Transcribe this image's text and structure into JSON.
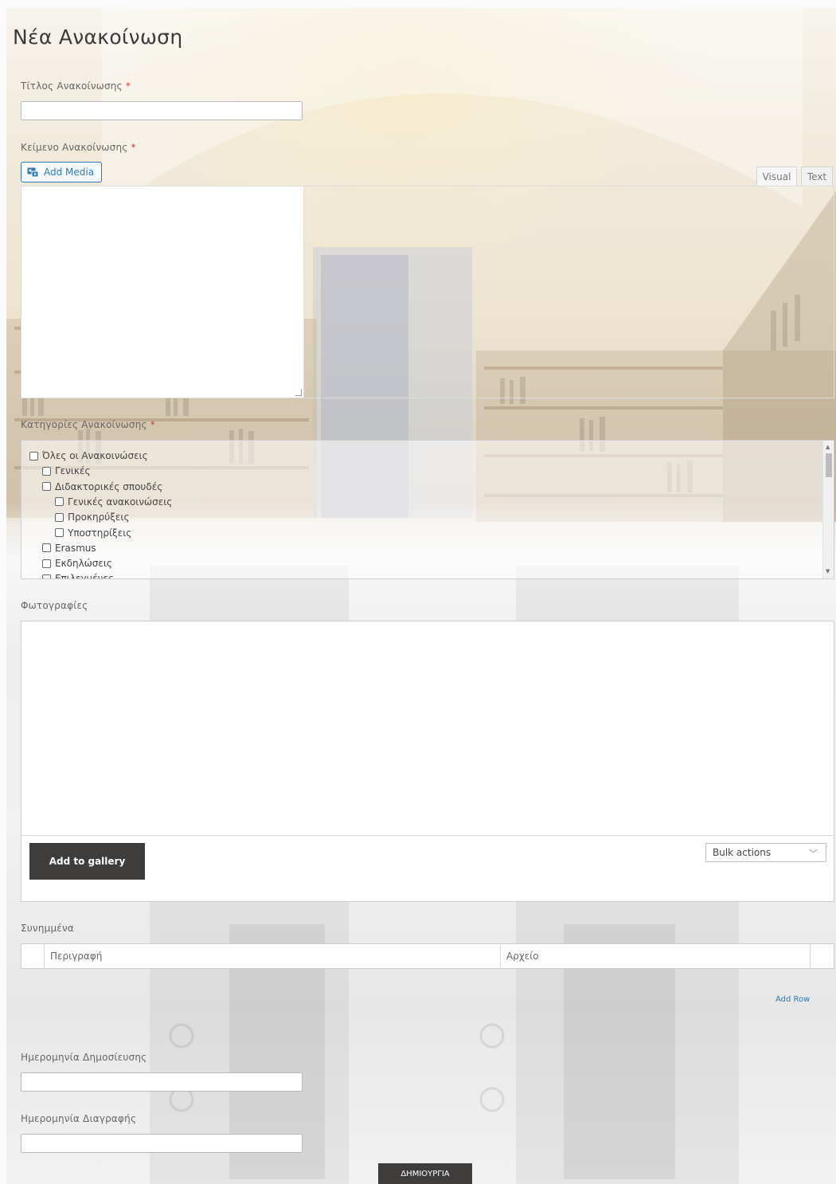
{
  "page": {
    "title": "Νέα Ανακοίνωση"
  },
  "announcement_title": {
    "label": "Τίτλος Ανακοίνωσης",
    "required_mark": "*",
    "value": ""
  },
  "announcement_text": {
    "label": "Κείμενο Ανακοίνωσης",
    "required_mark": "*",
    "add_media_label": "Add Media",
    "tabs": [
      {
        "label": "Visual",
        "active": true
      },
      {
        "label": "Text",
        "active": false
      }
    ],
    "value": ""
  },
  "categories": {
    "label": "Κατηγορίες Ανακοίνωσης",
    "required_mark": "*",
    "items": [
      {
        "label": "Όλες οι Ανακοινώσεις",
        "level": 0,
        "checked": false
      },
      {
        "label": "Γενικές",
        "level": 1,
        "checked": false
      },
      {
        "label": "Διδακτορικές σπουδές",
        "level": 1,
        "checked": false
      },
      {
        "label": "Γενικές ανακοινώσεις",
        "level": 2,
        "checked": false
      },
      {
        "label": "Προκηρύξεις",
        "level": 2,
        "checked": false
      },
      {
        "label": "Υποστηρίξεις",
        "level": 2,
        "checked": false
      },
      {
        "label": "Erasmus",
        "level": 1,
        "checked": false
      },
      {
        "label": "Εκδηλώσεις",
        "level": 1,
        "checked": false
      },
      {
        "label": "Επιλεγμένες",
        "level": 1,
        "checked": false
      }
    ]
  },
  "photos": {
    "label": "Φωτογραφίες",
    "add_button": "Add to gallery",
    "bulk_actions": "Bulk actions"
  },
  "attachments": {
    "label": "Συνημμένα",
    "columns": [
      "Περιγραφή",
      "Αρχείο"
    ],
    "add_row": "Add Row"
  },
  "publish_date": {
    "label": "Ημερομηνία Δημοσίευσης",
    "value": ""
  },
  "delete_date": {
    "label": "Ημερομηνία Διαγραφής",
    "value": ""
  },
  "submit": {
    "label": "ΔΗΜΙΟΥΡΓΙΑ"
  },
  "colors": {
    "accent": "#2e7bb8",
    "required": "#d63b3b",
    "dark_button": "#3f3c3c"
  }
}
